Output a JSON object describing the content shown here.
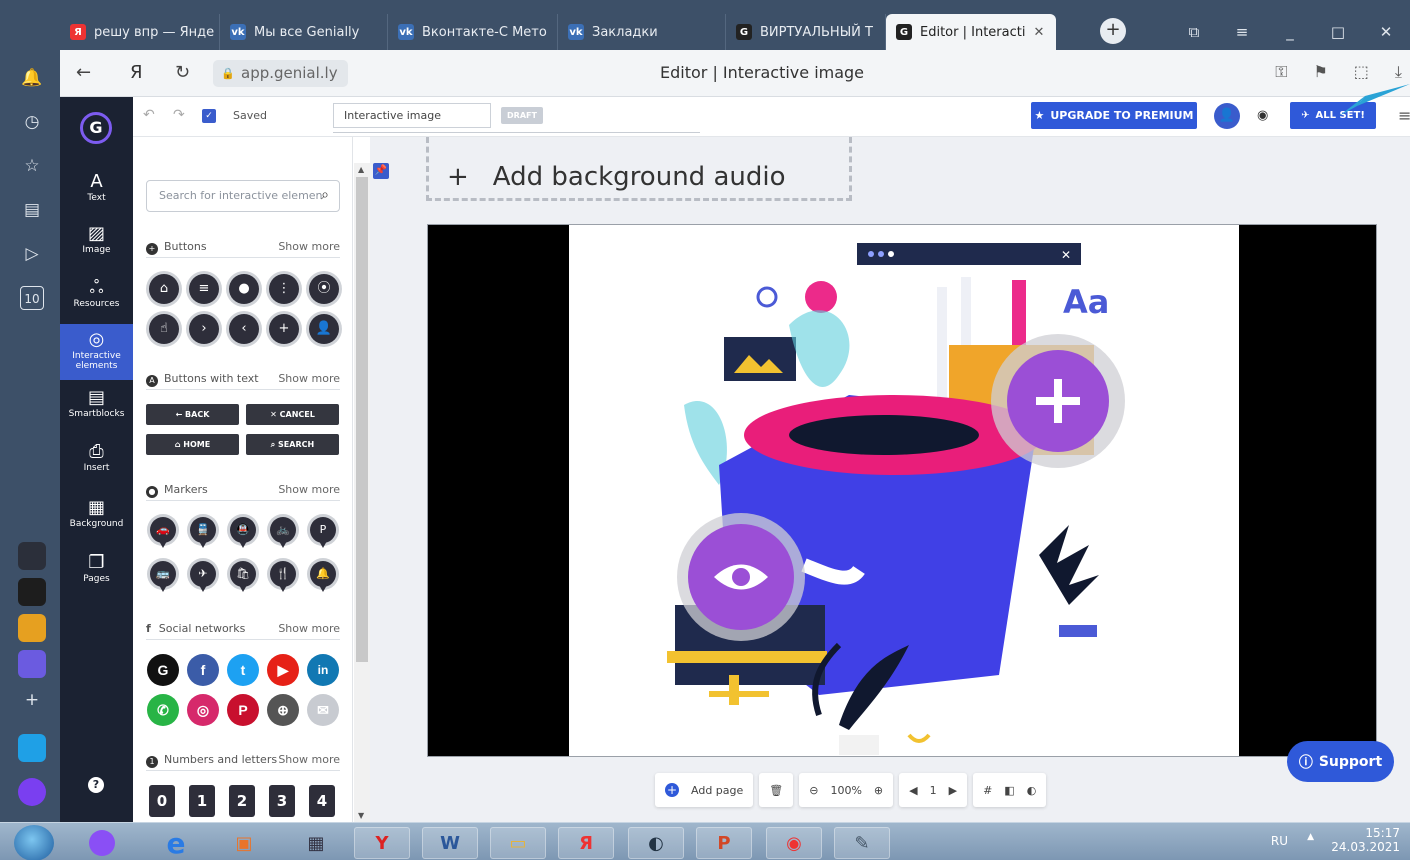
{
  "browser": {
    "tabs": [
      {
        "label": "решу впр — Янде",
        "icon": "Я",
        "color": "#e33"
      },
      {
        "label": "Мы все Genially",
        "icon": "vk",
        "color": "#3b6fb6"
      },
      {
        "label": "Вконтакте-С Мето",
        "icon": "vk",
        "color": "#3b6fb6"
      },
      {
        "label": "Закладки",
        "icon": "vk",
        "color": "#3b6fb6"
      },
      {
        "label": "ВИРТУАЛЬНЫЙ Т",
        "icon": "G",
        "color": "#222"
      },
      {
        "label": "Editor | Interacti",
        "icon": "G",
        "color": "#222",
        "active": true
      }
    ],
    "url": "app.genial.ly",
    "page_title": "Editor | Interactive image",
    "sidebar_badge": "10"
  },
  "toolbar": {
    "saved_label": "Saved",
    "title_value": "Interactive image",
    "draft_label": "DRAFT",
    "upgrade_label": "UPGRADE TO PREMIUM",
    "allset_label": "ALL SET!"
  },
  "sidebar": {
    "items": [
      {
        "label": "Text",
        "icon": "A"
      },
      {
        "label": "Image",
        "icon": "▨"
      },
      {
        "label": "Resources",
        "icon": "ஃ"
      },
      {
        "label": "Interactive elements",
        "icon": "◎"
      },
      {
        "label": "Smartblocks",
        "icon": "▤"
      },
      {
        "label": "Insert",
        "icon": "⎙"
      },
      {
        "label": "Background",
        "icon": "▦"
      },
      {
        "label": "Pages",
        "icon": "❐"
      }
    ],
    "help": "?"
  },
  "panel": {
    "search_placeholder": "Search for interactive elemen",
    "show_more": "Show more",
    "sections": {
      "buttons": "Buttons",
      "buttons_text": "Buttons with text",
      "markers": "Markers",
      "social": "Social networks",
      "numbers": "Numbers and letters"
    },
    "text_buttons": [
      "← BACK",
      "✕ CANCEL",
      "⌂ HOME",
      "⌕ SEARCH"
    ],
    "numbers": [
      "0",
      "1",
      "2",
      "3",
      "4"
    ]
  },
  "canvas": {
    "bg_audio_label": "Add background audio",
    "illustration_text": "Aa"
  },
  "bottombar": {
    "add_page": "Add page",
    "zoom": "100%",
    "page_number": "1"
  },
  "support_label": "Support",
  "taskbar": {
    "lang": "RU",
    "time": "15:17",
    "date": "24.03.2021"
  },
  "colors": {
    "accent": "#2f59d9",
    "sidebar": "#1b2232",
    "browser_chrome": "#3d5068",
    "hotspot": "#9b4fd6"
  }
}
